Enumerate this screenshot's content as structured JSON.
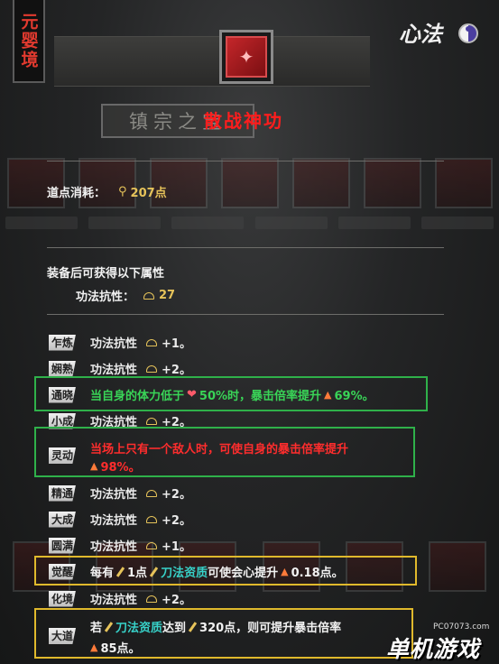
{
  "realm": "元婴境",
  "top_right": {
    "label": "心法",
    "icon": "taiji-icon"
  },
  "popup": {
    "book_icon": "red-book-icon",
    "plaque": "镇宗之宝",
    "title": "散战神功",
    "cost": {
      "label": "道点消耗：",
      "value": "207点",
      "icon": "pin-icon"
    },
    "equip_title": "装备后可获得以下属性",
    "equip_stat": {
      "label": "功法抗性：",
      "value": "27",
      "icon": "shield-icon"
    },
    "levels": [
      {
        "badge": "乍炼",
        "text": "功法抗性",
        "value": "+1。"
      },
      {
        "badge": "娴熟",
        "text": "功法抗性",
        "value": "+2。"
      },
      {
        "badge": "通晓",
        "special": "tongxiao"
      },
      {
        "badge": "小成",
        "text": "功法抗性",
        "value": "+2。"
      },
      {
        "badge": "灵动",
        "special": "lingdong"
      },
      {
        "badge": "精通",
        "text": "功法抗性",
        "value": "+2。"
      },
      {
        "badge": "大成",
        "text": "功法抗性",
        "value": "+2。"
      },
      {
        "badge": "圆满",
        "text": "功法抗性",
        "value": "+1。"
      },
      {
        "badge": "觉醒",
        "special": "juexing"
      },
      {
        "badge": "化境",
        "text": "功法抗性",
        "value": "+2。"
      },
      {
        "badge": "大道",
        "special": "dadao"
      }
    ],
    "tongxiao": {
      "a": "当自身的体力低于",
      "b": "50%时，暴击倍率提升",
      "c": "69%。"
    },
    "lingdong": {
      "a": "当场上只有一个敌人时，可使自身的暴击倍率提升",
      "b": "98%。"
    },
    "juexing": {
      "a": "每有",
      "b": "1点",
      "c": "刀法资质",
      "d": "可使会心提升",
      "e": "0.18点。"
    },
    "dadao": {
      "a": "若",
      "b": "刀法资质",
      "c": "达到",
      "d": "320点，则可提升暴击倍率",
      "e": "85点。"
    }
  },
  "watermark": {
    "url": "PC07073.com",
    "text": "单机游戏"
  }
}
